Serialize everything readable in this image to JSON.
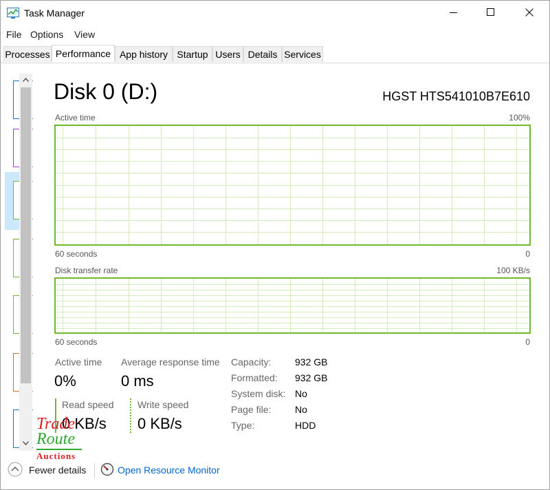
{
  "window": {
    "title": "Task Manager",
    "controls": [
      "minimize",
      "maximize",
      "close"
    ]
  },
  "menu": [
    "File",
    "Options",
    "View"
  ],
  "tabs": [
    {
      "label": "Processes"
    },
    {
      "label": "Performance",
      "active": true
    },
    {
      "label": "App history"
    },
    {
      "label": "Startup"
    },
    {
      "label": "Users"
    },
    {
      "label": "Details"
    },
    {
      "label": "Services"
    }
  ],
  "sidebar": {
    "selected_index": 2,
    "thumb_colors": [
      "#1a73c9",
      "#9b3fbf",
      "#6fba2c",
      "#6fba2c",
      "#6fba2c",
      "#c8732a",
      "#1a73c9"
    ]
  },
  "disk": {
    "title": "Disk 0 (D:)",
    "model": "HGST HTS541010B7E610"
  },
  "graphs": {
    "active_time": {
      "label": "Active time",
      "max": "100%",
      "time_label": "60 seconds",
      "min": "0",
      "color": "#6fba2c"
    },
    "transfer_rate": {
      "label": "Disk transfer rate",
      "max": "100 KB/s",
      "time_label": "60 seconds",
      "min": "0",
      "color": "#6fba2c"
    }
  },
  "stats": {
    "active_time": {
      "label": "Active time",
      "value": "0%"
    },
    "avg_response": {
      "label": "Average response time",
      "value": "0 ms"
    },
    "read_speed": {
      "label": "Read speed",
      "value": "0 KB/s"
    },
    "write_speed": {
      "label": "Write speed",
      "value": "0 KB/s"
    }
  },
  "properties": [
    {
      "label": "Capacity:",
      "value": "932 GB"
    },
    {
      "label": "Formatted:",
      "value": "932 GB"
    },
    {
      "label": "System disk:",
      "value": "No"
    },
    {
      "label": "Page file:",
      "value": "No"
    },
    {
      "label": "Type:",
      "value": "HDD"
    }
  ],
  "bottom": {
    "fewer_details": "Fewer details",
    "open_resource_monitor": "Open Resource Monitor"
  },
  "watermark": {
    "line1": "Trade",
    "line2": "Route",
    "line3": "Auctions"
  }
}
